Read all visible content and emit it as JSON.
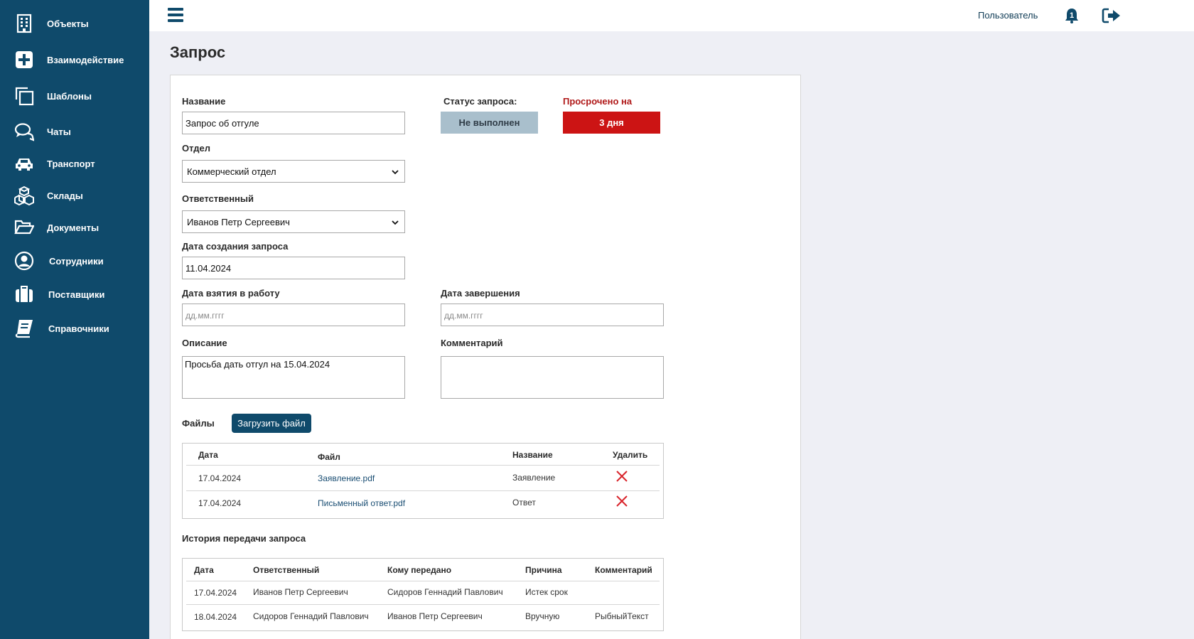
{
  "sidebar": {
    "items": [
      {
        "label": "Объекты",
        "icon": "building-icon"
      },
      {
        "label": "Взаимодействие",
        "icon": "plus-square-icon"
      },
      {
        "label": "Шаблоны",
        "icon": "copy-icon"
      },
      {
        "label": "Чаты",
        "icon": "chat-icon"
      },
      {
        "label": "Транспорт",
        "icon": "car-icon"
      },
      {
        "label": "Склады",
        "icon": "boxes-icon"
      },
      {
        "label": "Документы",
        "icon": "folder-open-icon"
      },
      {
        "label": "Сотрудники",
        "icon": "user-circle-icon"
      },
      {
        "label": "Поставщики",
        "icon": "briefcase-icon"
      },
      {
        "label": "Справочники",
        "icon": "book-icon"
      }
    ]
  },
  "header": {
    "user_label": "Пользователь",
    "notification_count": "1"
  },
  "page": {
    "title": "Запрос"
  },
  "form": {
    "name_label": "Название",
    "name_value": "Запрос об отгуле",
    "status_label": "Статус запроса:",
    "status_value": "Не выполнен",
    "overdue_label": "Просрочено на",
    "overdue_value": "3 дня",
    "department_label": "Отдел",
    "department_value": "Коммерческий отдел",
    "responsible_label": "Ответственный",
    "responsible_value": "Иванов Петр Сергеевич",
    "created_label": "Дата создания запроса",
    "created_value": "11.04.2024",
    "taken_label": "Дата взятия в работу",
    "taken_placeholder": "дд.мм.гггг",
    "completed_label": "Дата завершения",
    "completed_placeholder": "дд.мм.гггг",
    "description_label": "Описание",
    "description_value": "Просьба дать отгул на 15.04.2024",
    "comment_label": "Комментарий",
    "comment_value": ""
  },
  "files": {
    "label": "Файлы",
    "upload_label": "Загрузить файл",
    "columns": [
      "Дата",
      "Файл",
      "Название",
      "Удалить"
    ],
    "rows": [
      {
        "date": "17.04.2024",
        "file": "Заявление.pdf",
        "name": "Заявление"
      },
      {
        "date": "17.04.2024",
        "file": "Письменный ответ.pdf",
        "name": "Ответ"
      }
    ]
  },
  "history": {
    "label": "История передачи запроса",
    "columns": [
      "Дата",
      "Ответственный",
      "Кому передано",
      "Причина",
      "Комментарий"
    ],
    "rows": [
      {
        "date": "17.04.2024",
        "responsible": "Иванов Петр Сергеевич",
        "to": "Сидоров Геннадий Павлович",
        "reason": "Истек срок",
        "comment": ""
      },
      {
        "date": "18.04.2024",
        "responsible": "Сидоров Геннадий Павлович",
        "to": "Иванов Петр Сергеевич",
        "reason": "Вручную",
        "comment": "РыбныйТекст"
      }
    ]
  },
  "colors": {
    "sidebar": "#0f4a6b",
    "status_bg": "#a9bfcc",
    "overdue_bg": "#cc1414",
    "overdue_text": "#b01919",
    "delete": "#d9242b"
  }
}
